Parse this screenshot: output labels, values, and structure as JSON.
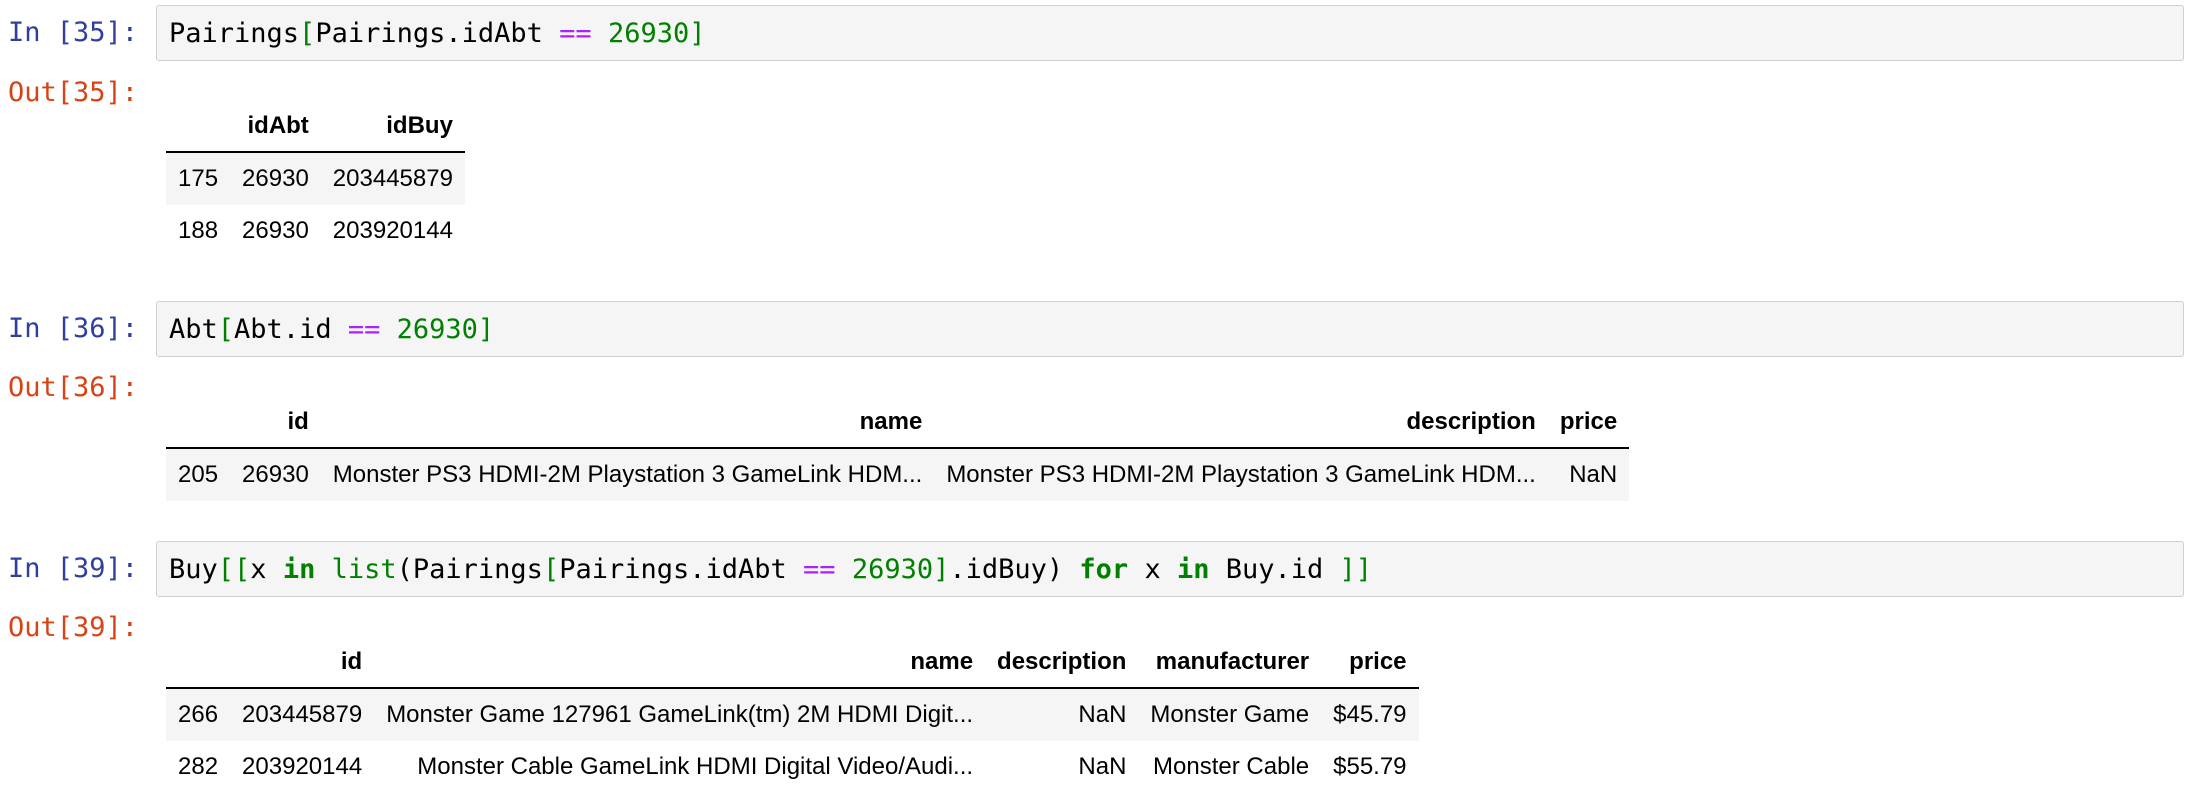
{
  "cells": [
    {
      "in_prompt": "In [35]:",
      "out_prompt": "Out[35]:",
      "code": {
        "t1": "Pairings",
        "t2": "[",
        "t3": "Pairings.idAbt ",
        "t4": "==",
        "t5": " ",
        "t6": "26930",
        "t7": "]"
      },
      "table": {
        "columns": [
          "",
          "idAbt",
          "idBuy"
        ],
        "rows": [
          {
            "index": "175",
            "cells": [
              "26930",
              "203445879"
            ]
          },
          {
            "index": "188",
            "cells": [
              "26930",
              "203920144"
            ]
          }
        ]
      }
    },
    {
      "in_prompt": "In [36]:",
      "out_prompt": "Out[36]:",
      "code": {
        "t1": "Abt",
        "t2": "[",
        "t3": "Abt.id ",
        "t4": "==",
        "t5": " ",
        "t6": "26930",
        "t7": "]"
      },
      "table": {
        "columns": [
          "",
          "id",
          "name",
          "description",
          "price"
        ],
        "rows": [
          {
            "index": "205",
            "cells": [
              "26930",
              "Monster PS3 HDMI-2M Playstation 3 GameLink HDM...",
              "Monster PS3 HDMI-2M Playstation 3 GameLink HDM...",
              "NaN"
            ]
          }
        ]
      }
    },
    {
      "in_prompt": "In [39]:",
      "out_prompt": "Out[39]:",
      "code": {
        "t1": "Buy",
        "t2": "[[",
        "t3": "x ",
        "t4": "in",
        "t5": " ",
        "t6": "list",
        "t7": "(Pairings",
        "t8": "[",
        "t9": "Pairings.idAbt ",
        "t10": "==",
        "t11": " ",
        "t12": "26930",
        "t13": "]",
        "t14": ".idBuy) ",
        "t15": "for",
        "t16": " x ",
        "t17": "in",
        "t18": " Buy.id ",
        "t19": "]]"
      },
      "table": {
        "columns": [
          "",
          "id",
          "name",
          "description",
          "manufacturer",
          "price"
        ],
        "rows": [
          {
            "index": "266",
            "cells": [
              "203445879",
              "Monster Game 127961 GameLink(tm) 2M HDMI Digit...",
              "NaN",
              "Monster Game",
              "$45.79"
            ]
          },
          {
            "index": "282",
            "cells": [
              "203920144",
              "Monster Cable GameLink HDMI Digital Video/Audi...",
              "NaN",
              "Monster Cable",
              "$55.79"
            ]
          }
        ]
      }
    }
  ]
}
